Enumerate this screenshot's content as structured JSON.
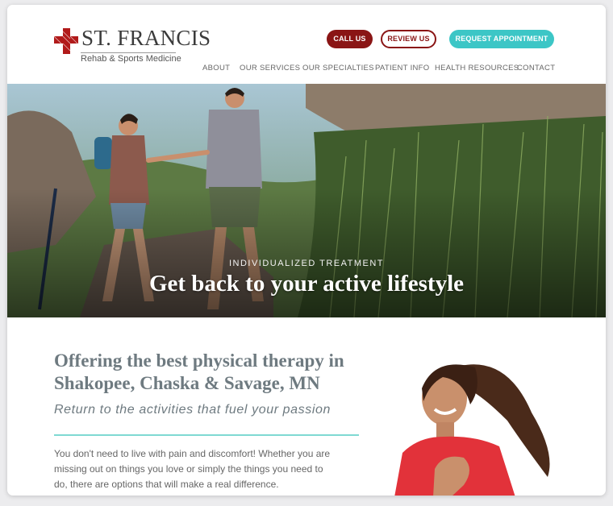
{
  "brand": {
    "name": "ST. FRANCIS",
    "subtitle": "Rehab & Sports Medicine",
    "colors": {
      "primary": "#8a1515",
      "accent": "#3cc6c6",
      "text_gray": "#6e7a80"
    }
  },
  "actions": {
    "call": "CALL US",
    "review": "REVIEW US",
    "appointment": "REQUEST APPOINTMENT"
  },
  "nav": [
    "ABOUT",
    "OUR SERVICES",
    "OUR SPECIALTIES",
    "PATIENT INFO",
    "HEALTH RESOURCES",
    "CONTACT"
  ],
  "hero": {
    "kicker": "INDIVIDUALIZED TREATMENT",
    "title": "Get back to your active lifestyle"
  },
  "intro": {
    "headline": "Offering the best physical therapy in Shakopee, Chaska & Savage, MN",
    "tagline": "Return to the activities that fuel your passion",
    "body": "You don't need to live with pain and discomfort! Whether you are missing out on things you love or simply the things you need to do, there are options that will make a real difference."
  }
}
